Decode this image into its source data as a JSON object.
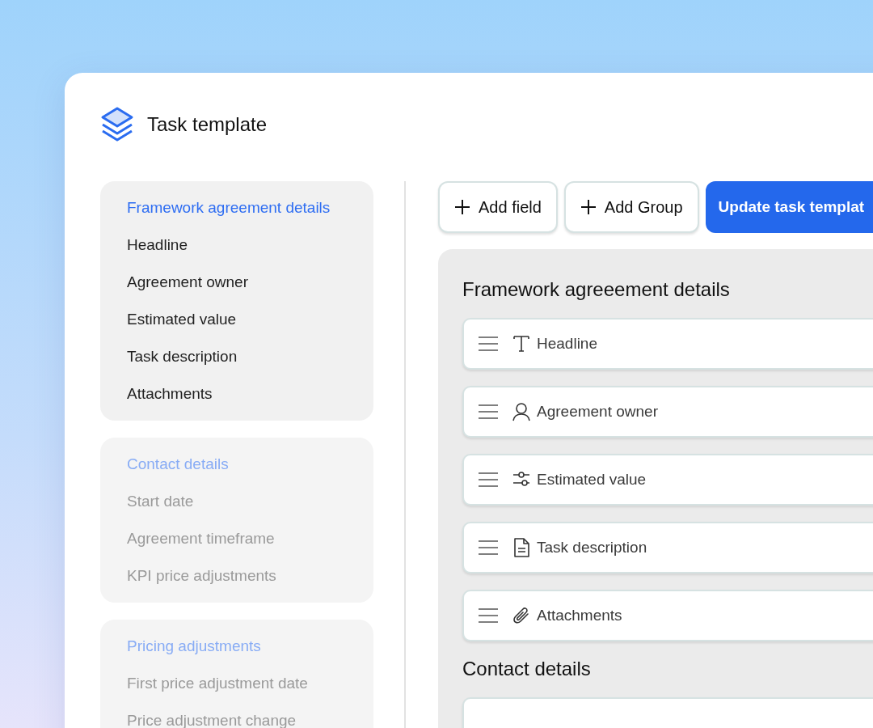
{
  "header": {
    "title": "Task template"
  },
  "sidebar": {
    "groups": [
      {
        "title": "Framework agreement details",
        "selected": true,
        "items": [
          "Headline",
          "Agreement owner",
          "Estimated value",
          "Task description",
          "Attachments"
        ]
      },
      {
        "title": "Contact details",
        "selected": false,
        "items": [
          "Start date",
          "Agreement timeframe",
          "KPI price adjustments"
        ]
      },
      {
        "title": "Pricing adjustments",
        "selected": false,
        "items": [
          "First price adjustment date",
          "Price adjustment change"
        ]
      }
    ]
  },
  "toolbar": {
    "buttons": [
      {
        "label": "Add field",
        "kind": "add"
      },
      {
        "label": "Add Group",
        "kind": "add"
      },
      {
        "label": "Update task templat",
        "kind": "primary"
      }
    ]
  },
  "sections": [
    {
      "title": "Framework agreeement details",
      "fields": [
        {
          "label": "Headline",
          "kind": "text"
        },
        {
          "label": "Agreement owner",
          "kind": "person"
        },
        {
          "label": "Estimated value",
          "kind": "slider"
        },
        {
          "label": "Task description",
          "kind": "document"
        },
        {
          "label": "Attachments",
          "kind": "attachment"
        }
      ]
    },
    {
      "title": "Contact details",
      "fields": [
        {
          "kind": "empty"
        }
      ]
    }
  ]
}
